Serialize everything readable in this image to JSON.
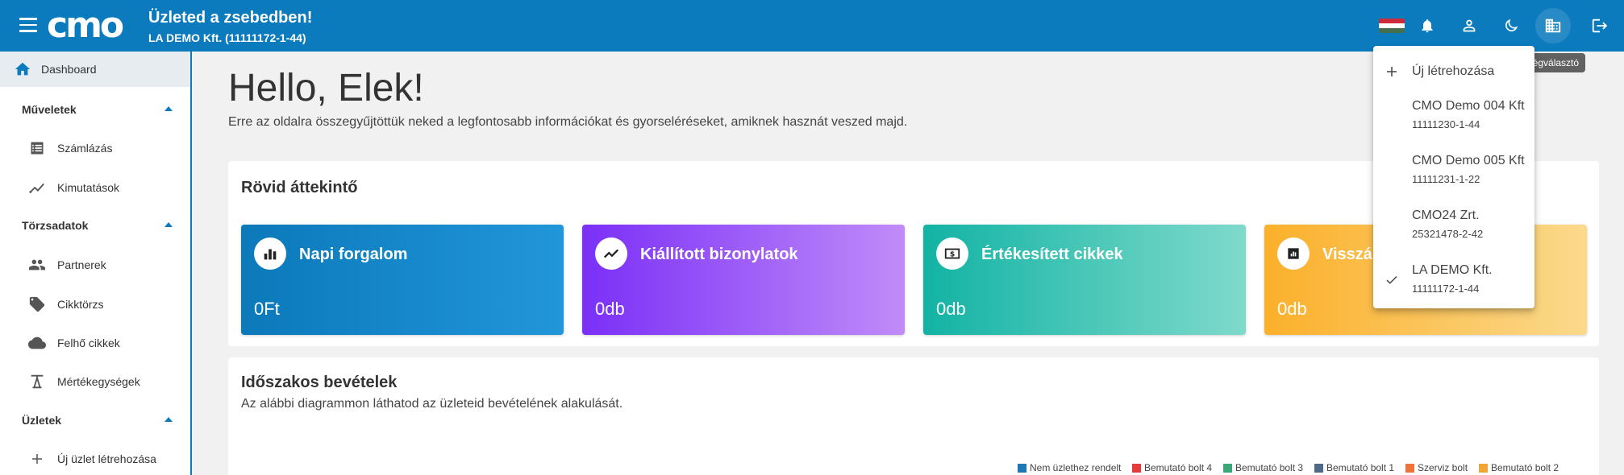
{
  "header": {
    "logo_text": "cmo",
    "title": "Üzleted a zsebedben!",
    "subtitle": "LA DEMO Kft. (11111172-1-44)",
    "tooltip": "Cégválasztó",
    "icons": [
      "menu-icon",
      "hungarian-flag",
      "bell-icon",
      "account-icon",
      "dark-mode-icon",
      "company-icon",
      "logout-icon"
    ]
  },
  "sidebar": {
    "dashboard": "Dashboard",
    "sections": [
      {
        "label": "Műveletek",
        "items": [
          "Számlázás",
          "Kimutatások"
        ]
      },
      {
        "label": "Törzsadatok",
        "items": [
          "Partnerek",
          "Cikktörzs",
          "Felhő cikkek",
          "Mértékegységek"
        ]
      },
      {
        "label": "Üzletek",
        "items": [
          "Új üzlet létrehozása"
        ]
      }
    ]
  },
  "main": {
    "greeting": "Hello, Elek!",
    "greeting_sub": "Erre az oldalra összegyűjtöttük neked a legfontosabb információkat és gyorseléréseket, amiknek hasznát veszed majd.",
    "overview": {
      "title": "Rövid áttekintő",
      "tiles": [
        {
          "title": "Napi forgalom",
          "value": "0Ft",
          "icon": "bar-chart-icon"
        },
        {
          "title": "Kiállított bizonylatok",
          "value": "0db",
          "icon": "trending-icon"
        },
        {
          "title": "Értékesített cikkek",
          "value": "0db",
          "icon": "money-icon"
        },
        {
          "title": "Visszá",
          "value": "0db",
          "icon": "report-icon"
        }
      ]
    },
    "revenue": {
      "title": "Időszakos bevételek",
      "subtitle": "Az alábbi diagrammon láthatod az üzleteid bevételének alakulását.",
      "legend": [
        {
          "name": "Nem üzlethez rendelt",
          "color": "#1f77b4"
        },
        {
          "name": "Bemutató bolt 4",
          "color": "#e63b3b"
        },
        {
          "name": "Bemutató bolt 3",
          "color": "#3aa776"
        },
        {
          "name": "Bemutató bolt 1",
          "color": "#4e6a88"
        },
        {
          "name": "Szerviz bolt",
          "color": "#f0743a"
        },
        {
          "name": "Bemutató bolt 2",
          "color": "#f2a531"
        }
      ]
    }
  },
  "company_menu": {
    "create_label": "Új létrehozása",
    "companies": [
      {
        "name": "CMO Demo 004 Kft",
        "tax": "11111230-1-44",
        "selected": false
      },
      {
        "name": "CMO Demo 005 Kft",
        "tax": "11111231-1-22",
        "selected": false
      },
      {
        "name": "CMO24 Zrt.",
        "tax": "25321478-2-42",
        "selected": false
      },
      {
        "name": "LA DEMO Kft.",
        "tax": "11111172-1-44",
        "selected": true
      }
    ]
  }
}
